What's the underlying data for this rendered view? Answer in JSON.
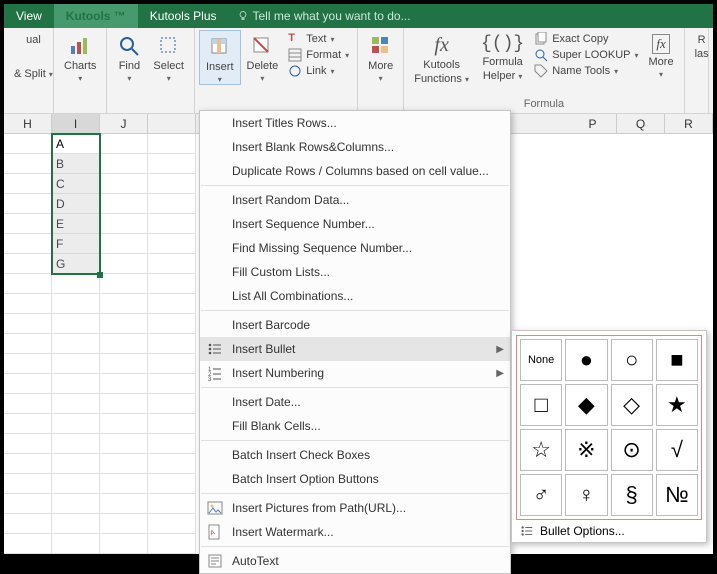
{
  "tabs": {
    "view": "View",
    "kutools": "Kutools ™",
    "kutools_plus": "Kutools Plus",
    "tellme": "Tell me what you want to do..."
  },
  "ribbon": {
    "split": "& Split",
    "visual": "ual",
    "charts": "Charts",
    "find": "Find",
    "select": "Select",
    "insert": "Insert",
    "delete": "Delete",
    "text": "Text",
    "format": "Format",
    "link": "Link",
    "more1": "More",
    "kfunctions_a": "Kutools",
    "kfunctions_b": "Functions",
    "fhelper_a": "Formula",
    "fhelper_b": "Helper",
    "exactcopy": "Exact Copy",
    "superlookup": "Super LOOKUP",
    "nametools": "Name Tools",
    "more2": "More",
    "r": "R",
    "las": "las",
    "formula_group": "Formula"
  },
  "columns": [
    "H",
    "I",
    "J",
    "",
    "",
    "",
    "",
    "P",
    "Q",
    "R"
  ],
  "cells": [
    "A",
    "B",
    "C",
    "D",
    "E",
    "F",
    "G"
  ],
  "menu": {
    "titles_rows": "Insert Titles Rows...",
    "blank_rc": "Insert Blank Rows&Columns...",
    "dup_rows": "Duplicate Rows / Columns based on cell value...",
    "random": "Insert Random Data...",
    "seq_num": "Insert Sequence Number...",
    "find_missing": "Find Missing Sequence Number...",
    "fill_custom": "Fill Custom Lists...",
    "list_comb": "List All Combinations...",
    "barcode": "Insert Barcode",
    "bullet": "Insert Bullet",
    "numbering": "Insert Numbering",
    "date": "Insert Date...",
    "fill_blank": "Fill Blank Cells...",
    "check_boxes": "Batch Insert Check Boxes",
    "option_btns": "Batch Insert Option Buttons",
    "pics_path": "Insert Pictures from Path(URL)...",
    "watermark": "Insert Watermark...",
    "autotext": "AutoText"
  },
  "palette": {
    "none": "None",
    "options": "Bullet Options...",
    "glyphs": [
      "●",
      "○",
      "■",
      "□",
      "◆",
      "◇",
      "★",
      "☆",
      "※",
      "⊙",
      "√",
      "♂",
      "♀",
      "§",
      "№"
    ]
  }
}
